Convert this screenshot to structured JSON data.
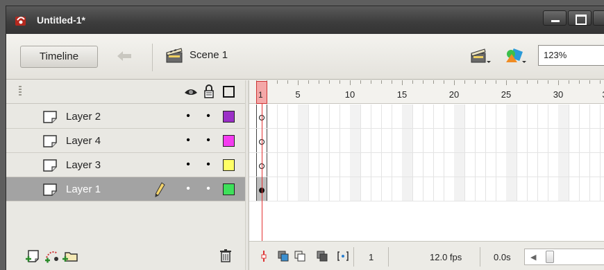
{
  "window": {
    "title": "Untitled-1*"
  },
  "toolbar": {
    "timeline_label": "Timeline",
    "scene_label": "Scene 1",
    "zoom_value": "123%"
  },
  "layers": [
    {
      "name": "Layer 2",
      "color": "#9b30c7",
      "selected": false
    },
    {
      "name": "Layer 4",
      "color": "#f43cf0",
      "selected": false
    },
    {
      "name": "Layer 3",
      "color": "#ffff66",
      "selected": false
    },
    {
      "name": "Layer 1",
      "color": "#3ee05a",
      "selected": true
    }
  ],
  "ruler": {
    "labels": [
      "1",
      "5",
      "10",
      "15",
      "20",
      "25",
      "30",
      "3"
    ]
  },
  "timeline_footer": {
    "current_frame": "1",
    "frame_rate": "12.0 fps",
    "elapsed_time": "0.0s"
  },
  "icons": {
    "header": [
      "eye-icon",
      "lock-icon",
      "outline-icon"
    ],
    "footer": [
      "insert-layer-icon",
      "add-motion-guide-icon",
      "insert-layer-folder-icon",
      "trash-icon"
    ]
  }
}
